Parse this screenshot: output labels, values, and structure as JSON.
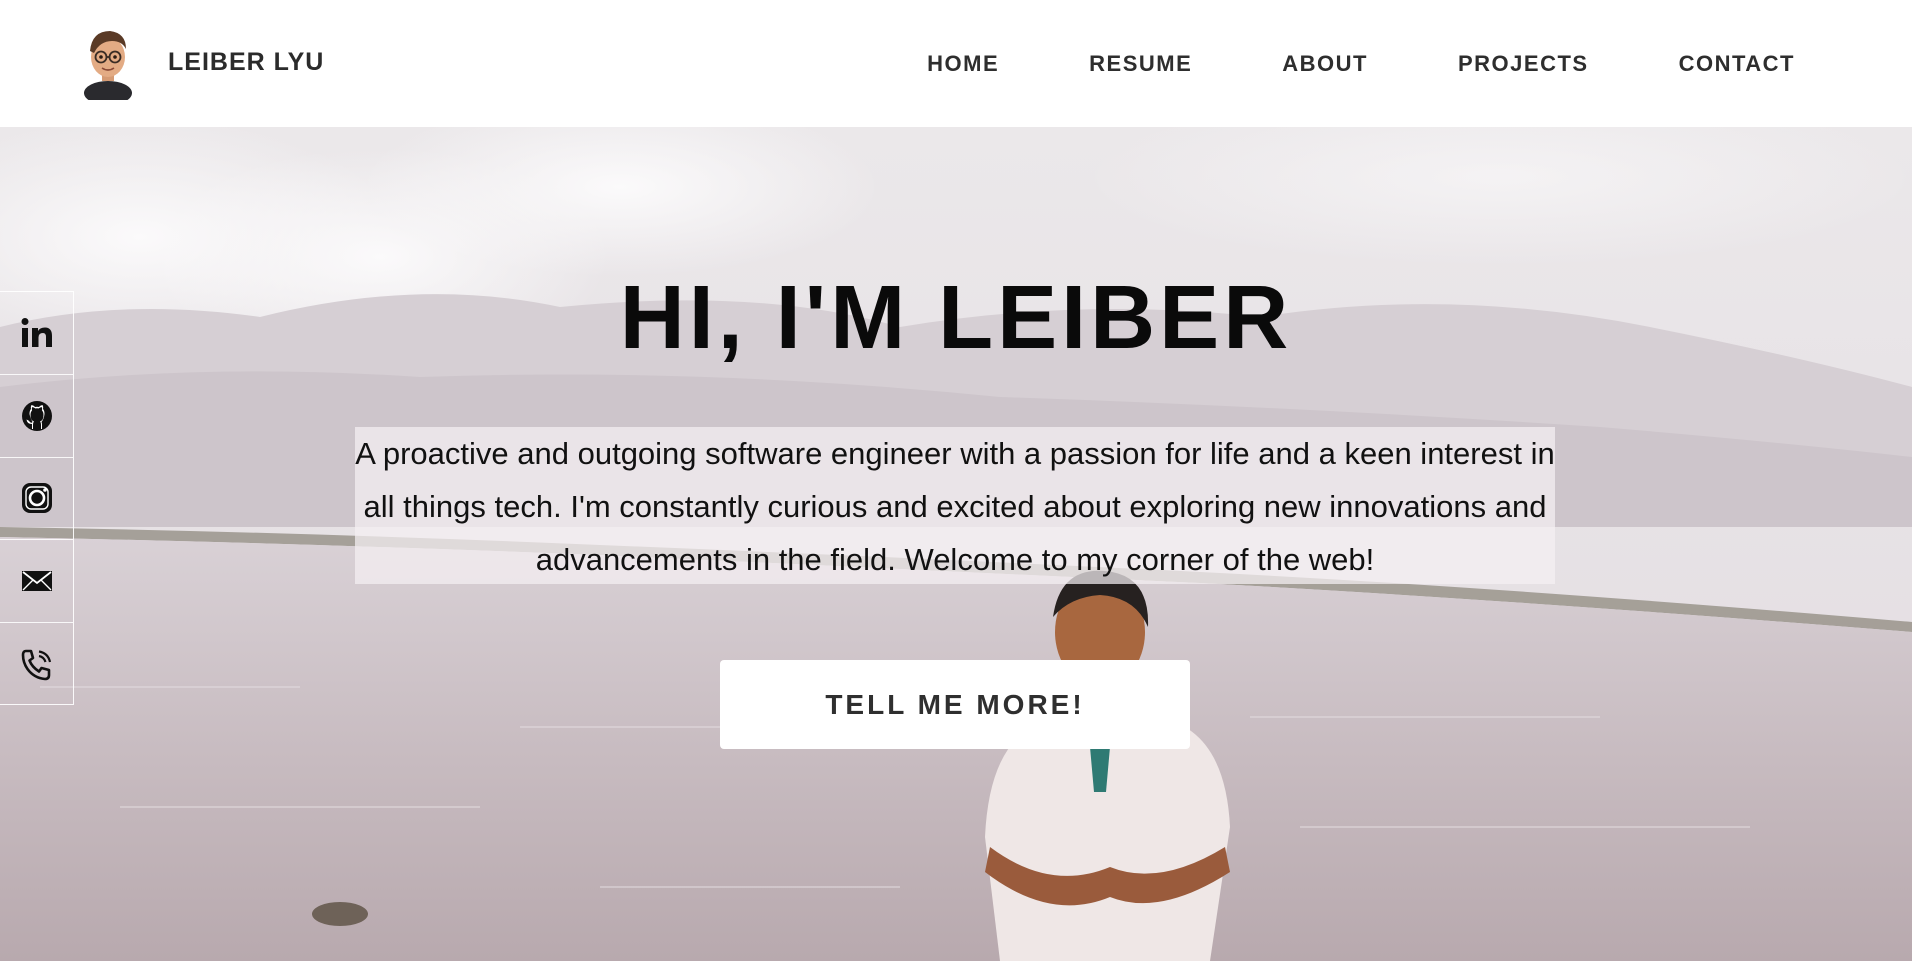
{
  "header": {
    "brand_name": "LEIBER LYU",
    "nav": [
      {
        "label": "HOME"
      },
      {
        "label": "RESUME"
      },
      {
        "label": "ABOUT"
      },
      {
        "label": "PROJECTS"
      },
      {
        "label": "CONTACT"
      }
    ]
  },
  "hero": {
    "title": "HI, I'M LEIBER",
    "description": "A proactive and outgoing software engineer with a passion for life and a keen interest in all things tech. I'm constantly curious and excited about exploring new innovations and advancements in the field. Welcome to my corner of the web!",
    "cta_label": "TELL ME MORE!"
  },
  "social": {
    "icons": [
      "linkedin-icon",
      "github-icon",
      "instagram-icon",
      "email-icon",
      "phone-icon"
    ]
  },
  "colors": {
    "header_bg": "#ffffff",
    "text_dark": "#2b2b2b",
    "sky": "#ece6ea",
    "water": "#c9bfc4"
  }
}
